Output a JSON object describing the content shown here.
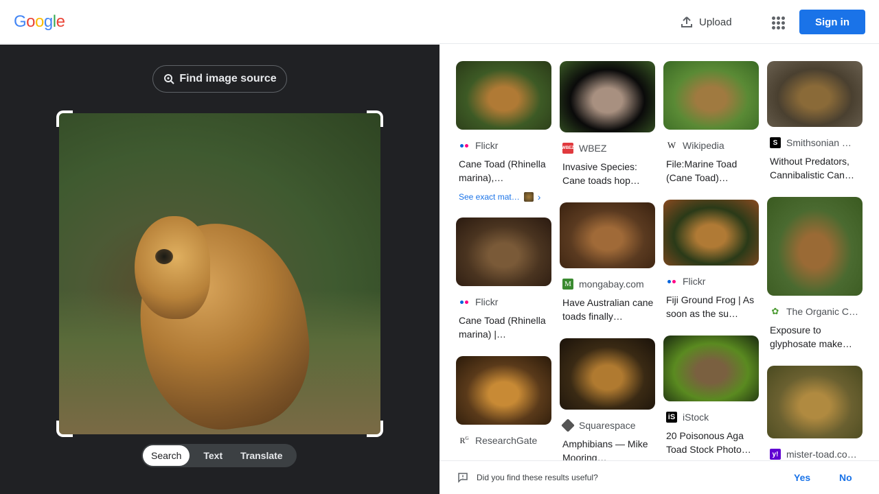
{
  "header": {
    "logo_letters": [
      "G",
      "o",
      "o",
      "g",
      "l",
      "e"
    ],
    "logo_colors": [
      "#4285F4",
      "#EA4335",
      "#FBBC05",
      "#4285F4",
      "#34A853",
      "#EA4335"
    ],
    "upload_label": "Upload",
    "signin_label": "Sign in"
  },
  "left": {
    "find_source_label": "Find image source",
    "modes": [
      "Search",
      "Text",
      "Translate"
    ],
    "active_mode": "Search"
  },
  "results": {
    "columns": [
      [
        {
          "source": "Flickr",
          "favicon": "flickr",
          "title": "Cane Toad (Rhinella marina),…",
          "exact_match": "See exact mat…",
          "thumb_colors": [
            "#3d5a25",
            "#b07a35",
            "#2a3a18"
          ],
          "thumb_h": 100
        },
        {
          "source": "Flickr",
          "favicon": "flickr",
          "title": "Cane Toad (Rhinella marina) |…",
          "thumb_colors": [
            "#4a3420",
            "#7a5a38",
            "#2a1a10"
          ],
          "thumb_h": 100
        },
        {
          "source": "ResearchGate",
          "favicon": "researchgate",
          "title": "",
          "thumb_colors": [
            "#5a3a1a",
            "#c88a35",
            "#2a1a0a"
          ],
          "thumb_h": 100
        }
      ],
      [
        {
          "source": "WBEZ",
          "favicon": "wbez",
          "title": "Invasive Species: Cane toads hop…",
          "thumb_colors": [
            "#0a0a0a",
            "#a89080",
            "#3a5a25"
          ],
          "thumb_h": 104
        },
        {
          "source": "mongabay.com",
          "favicon": "mongabay",
          "title": "Have Australian cane toads finally…",
          "thumb_colors": [
            "#5a3a20",
            "#a06a38",
            "#3a2210"
          ],
          "thumb_h": 96
        },
        {
          "source": "Squarespace",
          "favicon": "squarespace",
          "title": "Amphibians — Mike Mooring…",
          "thumb_colors": [
            "#3a2a14",
            "#b07a30",
            "#1a120a"
          ],
          "thumb_h": 104
        }
      ],
      [
        {
          "source": "Wikipedia",
          "favicon": "wikipedia",
          "title": "File:Marine Toad (Cane Toad)…",
          "thumb_colors": [
            "#5a8a35",
            "#a07a40",
            "#3a6a25"
          ],
          "thumb_h": 100
        },
        {
          "source": "Flickr",
          "favicon": "flickr",
          "title": "Fiji Ground Frog | As soon as the su…",
          "thumb_colors": [
            "#2a3a18",
            "#b07a35",
            "#8a4a20"
          ],
          "thumb_h": 96
        },
        {
          "source": "iStock",
          "favicon": "istock",
          "title": "20 Poisonous Aga Toad Stock Photo…",
          "thumb_colors": [
            "#5a8a20",
            "#7a6040",
            "#1a2a10"
          ],
          "thumb_h": 96
        }
      ],
      [
        {
          "source": "Smithsonian …",
          "favicon": "smithsonian",
          "title": "Without Predators, Cannibalistic Can…",
          "thumb_colors": [
            "#4a4030",
            "#8a6a38",
            "#6a6050"
          ],
          "thumb_h": 96
        },
        {
          "source": "The Organic C…",
          "favicon": "organic",
          "title": "Exposure to glyphosate make…",
          "thumb_colors": [
            "#4a6a30",
            "#9a6a35",
            "#3a5a20"
          ],
          "thumb_h": 144
        },
        {
          "source": "mister-toad.co…",
          "favicon": "yahoo",
          "title": "",
          "thumb_colors": [
            "#6a6030",
            "#b08a40",
            "#4a4a20"
          ],
          "thumb_h": 106
        }
      ]
    ]
  },
  "feedback": {
    "question": "Did you find these results useful?",
    "yes_label": "Yes",
    "no_label": "No"
  },
  "colors": {
    "accent": "#1a73e8",
    "left_bg": "#202124"
  }
}
